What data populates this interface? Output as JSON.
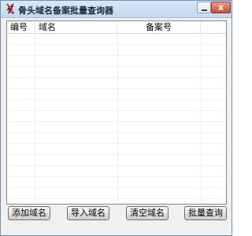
{
  "window": {
    "title": "骨头域名备案批量查询器",
    "close_glyph": "x"
  },
  "table": {
    "columns": [
      "编号",
      "域名",
      "备案号"
    ],
    "rows": []
  },
  "actions": {
    "add": "添加域名",
    "import": "导入域名",
    "clear": "清空域名",
    "query": "批量查询"
  }
}
